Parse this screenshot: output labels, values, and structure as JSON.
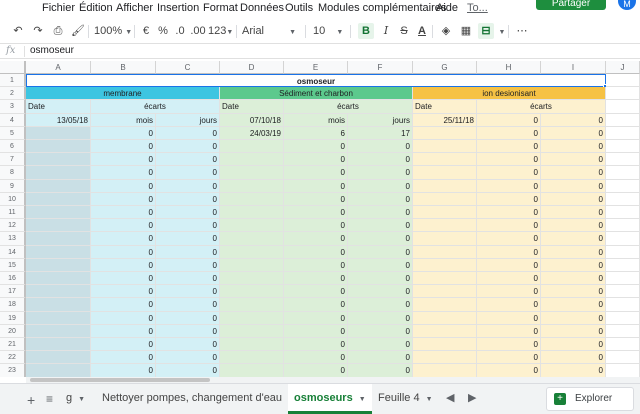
{
  "menu": {
    "items": [
      "Fichier",
      "Édition",
      "Afficher",
      "Insertion",
      "Format",
      "Données",
      "Outils",
      "Modules complémentaires",
      "Aide",
      "To..."
    ],
    "share_label": "Partager",
    "avatar_letter": "M"
  },
  "toolbar": {
    "zoom": "100%",
    "currency": "€",
    "percent": "%",
    "dec_decrease": ".0",
    "dec_increase": ".00",
    "format_more": "123",
    "font": "Arial",
    "font_size": "10",
    "bold": "B",
    "italic": "I",
    "strike": "S",
    "text_color": "A",
    "more": "⋯"
  },
  "formula_bar": {
    "fx": "fx",
    "content": "osmoseur"
  },
  "columns": [
    "A",
    "B",
    "C",
    "D",
    "E",
    "F",
    "G",
    "H",
    "I",
    "J"
  ],
  "rows": [
    "1",
    "2",
    "3",
    "4",
    "5",
    "6",
    "7",
    "8",
    "9",
    "10",
    "11",
    "12",
    "13",
    "14",
    "15",
    "16",
    "17",
    "18",
    "19",
    "20",
    "21",
    "22",
    "23"
  ],
  "sheet": {
    "title": "osmoseur",
    "groups": [
      "membrane",
      "Sédiment et charbon",
      "ion desionisant"
    ],
    "header_date": "Date",
    "header_ecarts": "écarts",
    "header_mois": "mois",
    "header_jours": "jours",
    "row4": {
      "a": "13/05/18",
      "b": "mois",
      "c": "jours",
      "d": "07/10/18",
      "e": "mois",
      "f": "jours",
      "g": "25/11/18",
      "h": "0",
      "i": "0"
    },
    "row5": {
      "a": "",
      "b": "0",
      "c": "0",
      "d": "24/03/19",
      "e": "6",
      "f": "17",
      "g": "",
      "h": "0",
      "i": "0"
    },
    "zero": "0"
  },
  "tabs": {
    "partial": "g",
    "items": [
      "Nettoyer pompes, changement d'eau",
      "osmoseurs",
      "Feuille 4"
    ],
    "active_index": 1,
    "explore_label": "Explorer",
    "add": "+",
    "list": "≡"
  },
  "colors": {
    "membrane": "#3dc5e1",
    "sediment": "#5cc98d",
    "ion": "#f6c244",
    "accent": "#188038"
  }
}
